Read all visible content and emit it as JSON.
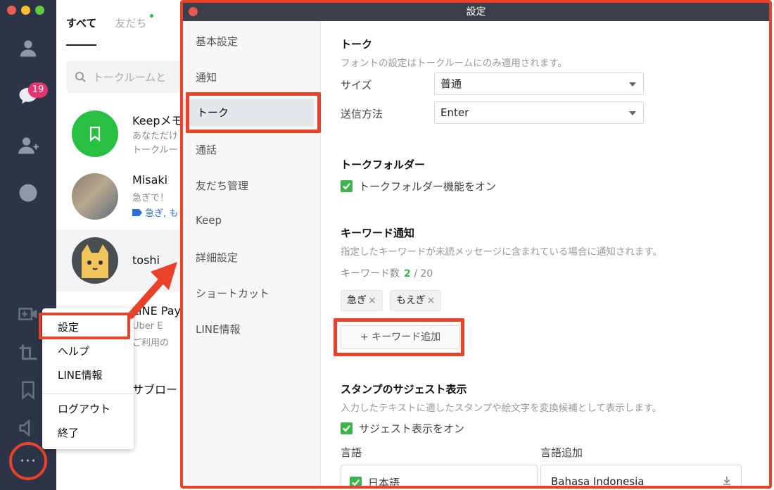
{
  "sidebar": {
    "chat_badge": "19",
    "more_label": "···"
  },
  "chat_list": {
    "tabs": [
      "すべて",
      "友だち"
    ],
    "search_placeholder": "トークルームと",
    "chats": [
      {
        "name": "Keepメモ",
        "line1": "あなただけ",
        "line2": "トークルー"
      },
      {
        "name": "Misaki",
        "line1": "急ぎで！",
        "tag": "急ぎ, も"
      },
      {
        "name": "toshi"
      },
      {
        "name": "LINE Pay",
        "line1": "Uber E",
        "line2": "ご利用の"
      },
      {
        "name": "サブロー"
      }
    ]
  },
  "context_menu": {
    "items": [
      "設定",
      "ヘルプ",
      "LINE情報",
      "ログアウト",
      "終了"
    ]
  },
  "settings": {
    "window_title": "設定",
    "nav": [
      "基本設定",
      "通知",
      "トーク",
      "通話",
      "友だち管理",
      "Keep",
      "詳細設定",
      "ショートカット",
      "LINE情報"
    ],
    "talk": {
      "heading": "トーク",
      "desc": "フォントの設定はトークルームにのみ適用されます。",
      "size_label": "サイズ",
      "size_value": "普通",
      "send_label": "送信方法",
      "send_value": "Enter"
    },
    "folder": {
      "heading": "トークフォルダー",
      "check_label": "トークフォルダー機能をオン"
    },
    "keyword": {
      "heading": "キーワード通知",
      "desc": "指定したキーワードが未読メッセージに含まれている場合に通知されます。",
      "count_label": "キーワード数",
      "count_current": "2",
      "count_max": "/ 20",
      "chips": [
        "急ぎ",
        "もえぎ"
      ],
      "chip_remove": "×",
      "add_label": "+ キーワード追加"
    },
    "sticker": {
      "heading": "スタンプのサジェスト表示",
      "desc": "入力したテキストに適したスタンプや絵文字を変換候補として表示します。",
      "check_label": "サジェスト表示をオン",
      "lang_label": "言語",
      "lang_add_label": "言語追加",
      "lang_current": "日本語",
      "lang_option": "Bahasa Indonesia"
    }
  },
  "colors": {
    "highlight": "#e8422a",
    "check_green": "#3bb44c",
    "rail_bg": "#2b3547",
    "badge": "#e6326e"
  }
}
